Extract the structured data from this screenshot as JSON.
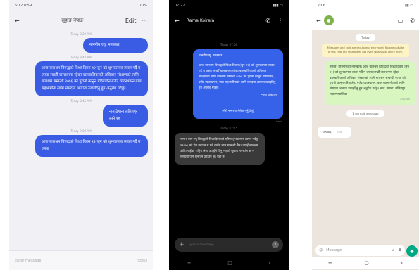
{
  "phone1": {
    "status_time": "5:12 8:59",
    "status_right": "70%",
    "contact_name": "सुहाङ नेपाङ",
    "edit_label": "Edit",
    "more_label": "···",
    "messages": [
      {
        "timestamp": "Today 8:29 AM",
        "text": "माननीय ज्यू, नमस्कार।"
      },
      {
        "timestamp": "Today 8:44 AM",
        "text": "आज बालश्रम विरुद्धको विश्व दिवस १२ जुन को शुभकामना व्यक्त गर्दै म जस्ता लाखौं बालश्रममा रहेका बालबालिकाको अधिकार संरक्षणको लागि बालश्रम सम्बन्धी २०५६ को पुरानो कानुन परिमार्जन बजेट व्यवस्थापन बाल सहभागीता लागि संसदमा आवाज उठाइदिनु हुन अनुरोध गर्दछु।"
      },
      {
        "timestamp": "Today 8:45 AM",
        "text": "नाम ठेगाना ललितपुर बस्ने १०"
      },
      {
        "timestamp": "Today 9:00 AM",
        "text": "आज बालश्रम विरुद्धको विश्व दिवस १२ जुन को शुभकामना व्यक्त गर्दै म जस्ता"
      }
    ],
    "input_placeholder": "Enter message",
    "send_label": "SEND"
  },
  "phone2": {
    "status_time": "07:27",
    "contact_name": "Rama Koirala",
    "ts1": "Today 07:06",
    "blue_message": {
      "greeting": "माननीयज्यू, नमस्कार।",
      "body": "आज बालश्रम विरुद्धको विश्व दिवस (जुन १२) को शुभकामना व्यक्त गर्दै म जस्ता लाखौँ बालश्रममा रहेका बालबालिकाको अधिकार संरक्षणको लागि बालश्रम सम्बन्धी २०५६ को पुरानो कानुन परिमार्जन, बजेट व्यवस्थापन, बाल सहभागीताको लागि संसदमा आवाज उठाइदिनु हुन अनुरोध गर्दछु।",
      "signature": "~रमा कोइराला",
      "cta": "(मेरो नम्बरमा मेसेज गर्नुहोस्)"
    },
    "sent_label": "Sent",
    "ts2": "Today 07:15",
    "dark_message": "नाम र थाप ज्यू विरुद्धको विश्वदिवसको सबैमा शुभकामना ज्ञापन गर्दछु १२०५६ को देश बनाउन म गर्न बढाँस बाल सम्बन्धी छैन। तपाईं बालश्रम उठी तपाईंका राष्ट्रिय छैन। उपाईले दिनु भएको सुझाव मनरयोग छ म संसदमा पनि सुनाउन उठाउने छु। यही छै",
    "input_placeholder": "Type a message"
  },
  "phone3": {
    "status_time": "7:06",
    "date_pill": "Today",
    "encryption_notice": "Messages and calls are end-to-end encrypted. No one outside of this chat can read them, not even WhatsApp. Learn more.",
    "green_message": {
      "body": "नमस्ते! माननीयज्यू नमस्कार। आज बालश्रम विरुद्धको विश्व दिवस (जुन १२) को शुभकामना व्यक्त गर्दै म जस्ता लाखौं बालश्रममा रहेका बालबालिकाको अधिकार संरक्षणको लागि बालश्रम सम्बन्धी २०५६ को पुरानो कानुन परिमार्जन, बजेट व्यवस्थापन, बाल सहभागीताको लागि संसदमा आवाज उठाइदिनु हुन अनुरोध गर्दछु। नाम: ठेगाना: ललितपुर महानगरपालिका ~",
      "time": "7:06 AM"
    },
    "deleted_pill": "1 unread message",
    "incoming_message": {
      "text": "धन्यवाद",
      "time": "7:08"
    },
    "input_placeholder": "Message"
  }
}
